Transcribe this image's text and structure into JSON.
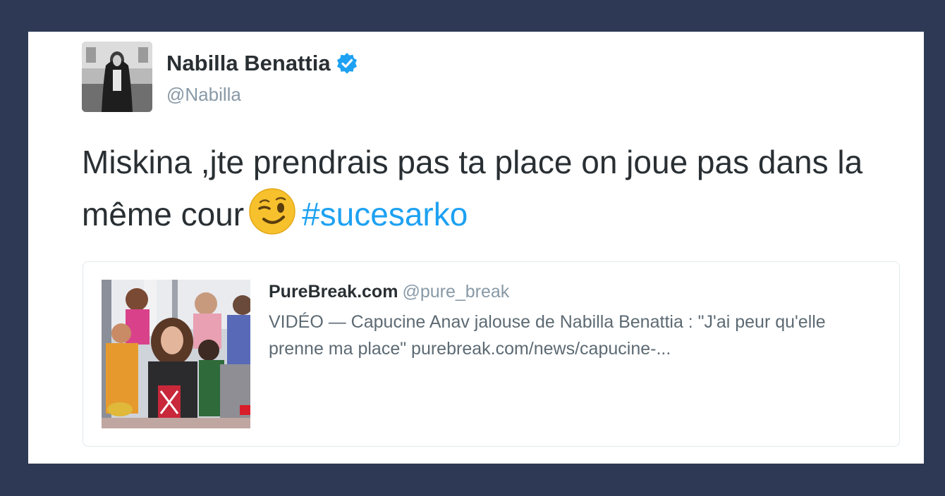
{
  "tweet": {
    "display_name": "Nabilla Benattia",
    "handle": "@Nabilla",
    "verified": true,
    "text_main": "Miskina ,jte prendrais pas ta place on joue pas dans la même cour",
    "emoji": "winking-face",
    "hashtag": "#sucesarko"
  },
  "quoted": {
    "name": "PureBreak.com",
    "handle": "@pure_break",
    "text": "VIDÉO — Capucine Anav jalouse de Nabilla Benattia : \"J'ai peur qu'elle prenne ma place\" purebreak.com/news/capucine-..."
  },
  "colors": {
    "page_background": "#2e3a55",
    "card_background": "#ffffff",
    "hashtag": "#1da1f2",
    "verified_badge": "#1da1f2",
    "secondary_text": "#8899a6"
  }
}
